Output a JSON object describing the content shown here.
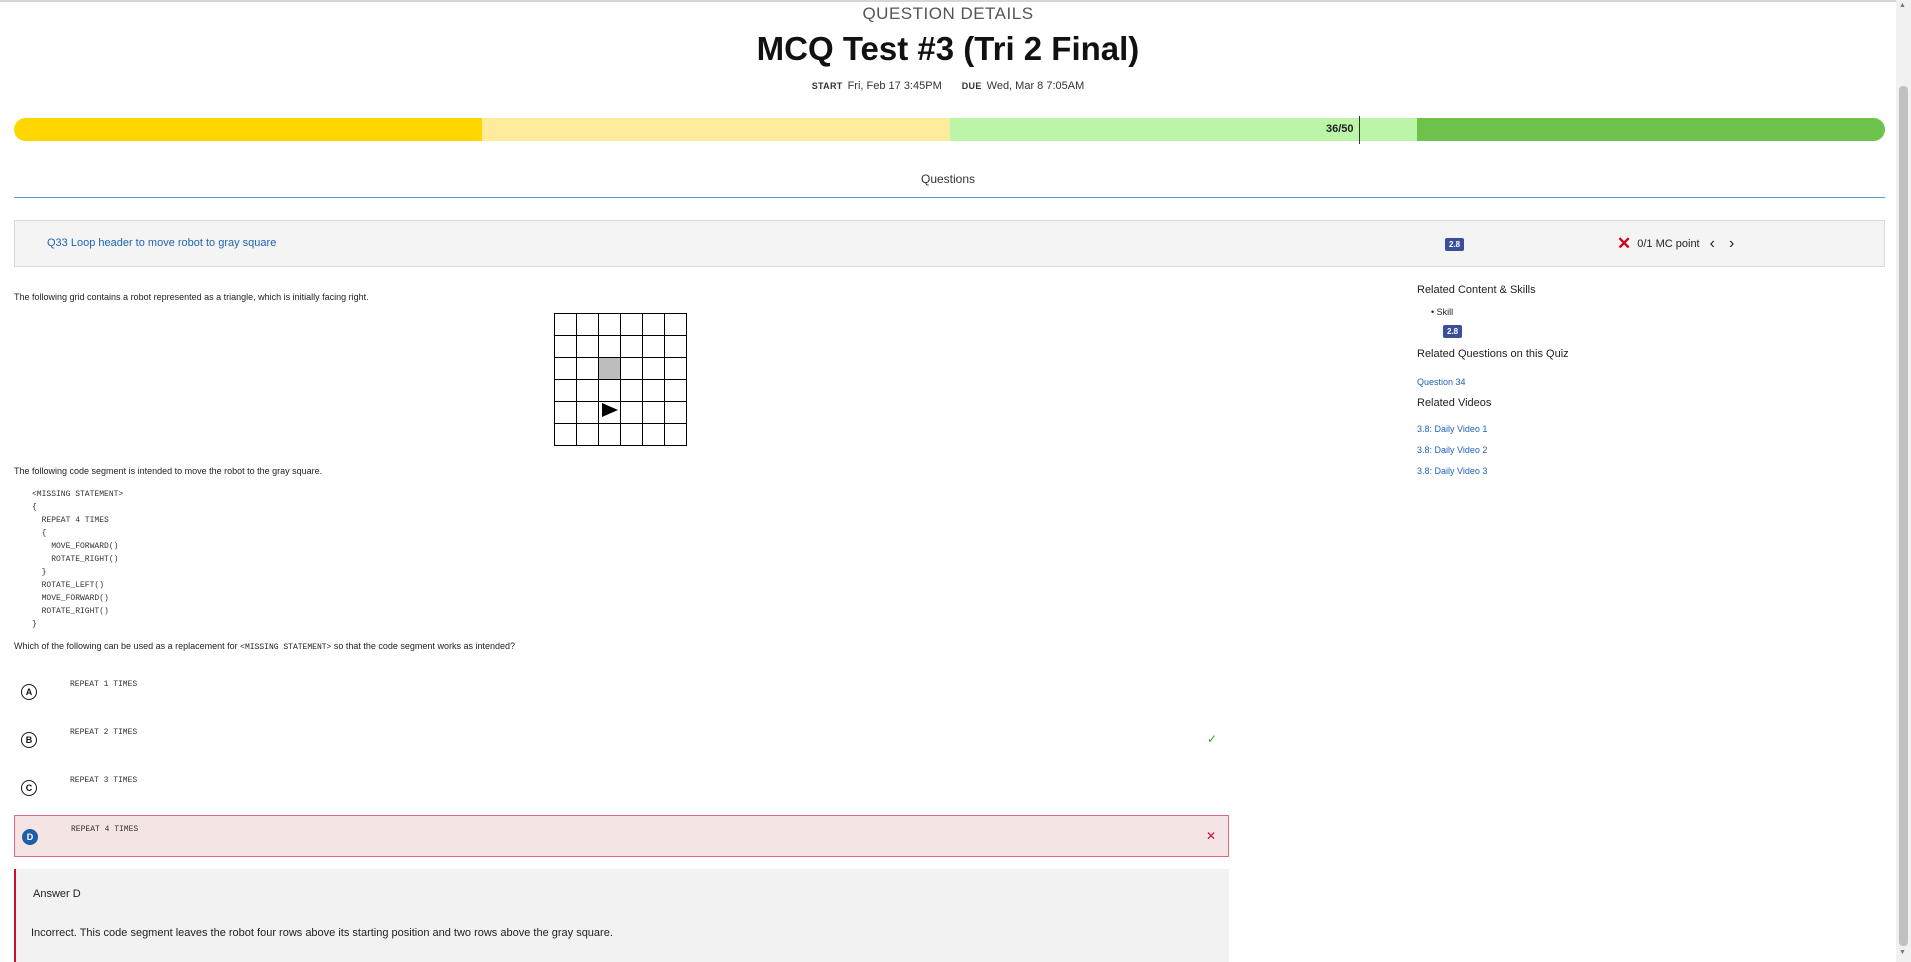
{
  "header": {
    "kicker": "QUESTION DETAILS",
    "title": "MCQ Test #3 (Tri 2 Final)",
    "start_label": "START",
    "start_value": "Fri, Feb 17 3:45PM",
    "due_label": "DUE",
    "due_value": "Wed, Mar 8 7:05AM"
  },
  "progress": {
    "label": "36/50",
    "value": 36,
    "max": 50,
    "colors": [
      "#ffd600",
      "#ffeb9c",
      "#bdf5a8",
      "#6cc24a"
    ]
  },
  "tabs": {
    "questions": "Questions"
  },
  "question_bar": {
    "title": "Q33 Loop header to move robot to gray square",
    "tag": "2.8",
    "score": "0/1 MC point",
    "prev_icon": "chevron-left-icon",
    "next_icon": "chevron-right-icon",
    "status_icon": "x-icon"
  },
  "question": {
    "intro": "The following grid contains a robot represented as a triangle, which is initially facing right.",
    "code_intro": "The following code segment is intended to move the robot to the gray square.",
    "code_lines": [
      "<MISSING STATEMENT>",
      "{",
      "  REPEAT 4 TIMES",
      "  {",
      "    MOVE_FORWARD()",
      "    ROTATE_RIGHT()",
      "  }",
      "  ROTATE_LEFT()",
      "  MOVE_FORWARD()",
      "  ROTATE_RIGHT()",
      "}"
    ],
    "prompt_before": "Which of the following can be used as a replacement for",
    "prompt_code": "<MISSING STATEMENT>",
    "prompt_after": "so that the code segment works as intended?"
  },
  "options": [
    {
      "letter": "A",
      "text": "REPEAT 1 TIMES",
      "mark": ""
    },
    {
      "letter": "B",
      "text": "REPEAT 2 TIMES",
      "mark": "✓"
    },
    {
      "letter": "C",
      "text": "REPEAT 3 TIMES",
      "mark": ""
    },
    {
      "letter": "D",
      "text": "REPEAT 4 TIMES",
      "mark": "✕"
    }
  ],
  "feedback": {
    "title": "Answer D",
    "body": "Incorrect. This code segment leaves the robot four rows above its starting position and two rows above the gray square."
  },
  "sidebar": {
    "related_heading": "Related Content & Skills",
    "skill_label": "Skill",
    "skill_tag": "2.8",
    "related_questions_heading": "Related Questions on this Quiz",
    "related_question": "Question 34",
    "related_videos_heading": "Related Videos",
    "videos": [
      "3.8: Daily Video 1",
      "3.8: Daily Video 2",
      "3.8: Daily Video 3"
    ]
  }
}
